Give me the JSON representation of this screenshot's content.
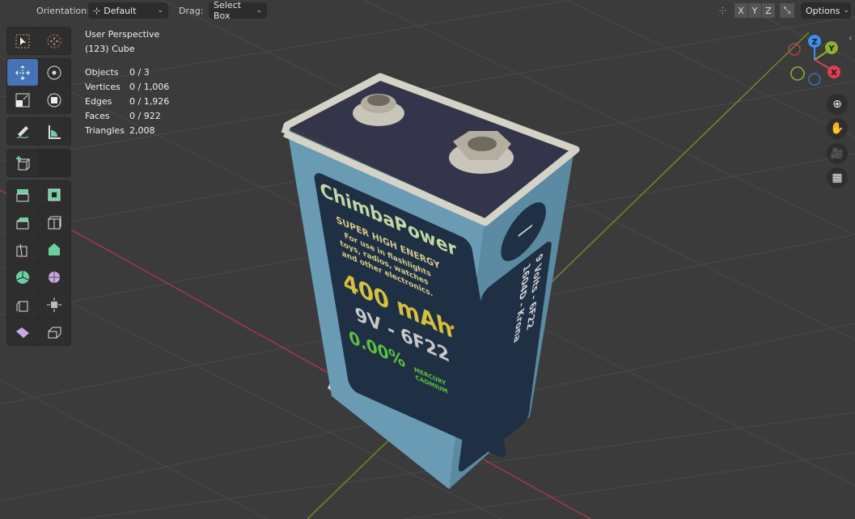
{
  "header": {
    "orientation_label": "Orientation:",
    "orientation_value": "Default",
    "drag_label": "Drag:",
    "drag_value": "Select Box",
    "axis_x": "X",
    "axis_y": "Y",
    "axis_z": "Z",
    "options_label": "Options"
  },
  "viewport": {
    "view_name": "User Perspective",
    "object_name": "(123) Cube"
  },
  "stats": [
    {
      "label": "Objects",
      "value": "0 / 3"
    },
    {
      "label": "Vertices",
      "value": "0 / 1,006"
    },
    {
      "label": "Edges",
      "value": "0 / 1,926"
    },
    {
      "label": "Faces",
      "value": "0 / 922"
    },
    {
      "label": "Triangles",
      "value": "2,008"
    }
  ],
  "gizmo": {
    "z": "Z",
    "y": "Y",
    "x": "X"
  },
  "battery_texture": {
    "brand": "ChimbaPower",
    "tagline": "SUPER HIGH ENERGY",
    "desc1": "For use in flashlights",
    "desc2": "toys, radios, watches",
    "desc3": "and other electronics.",
    "capacity": "400 mAh",
    "model": "9V - 6F22",
    "mercury": "0.00%",
    "mercury_label1": "MERCURY",
    "mercury_label2": "CADMIUM",
    "side1": "9 Volts - 6F22",
    "side2": "1604D - Krona",
    "minus": "−"
  },
  "colors": {
    "accent": "#4772b3",
    "x_axis": "#c7404e",
    "y_axis": "#7fa02a",
    "z_axis": "#3d8ef0"
  }
}
